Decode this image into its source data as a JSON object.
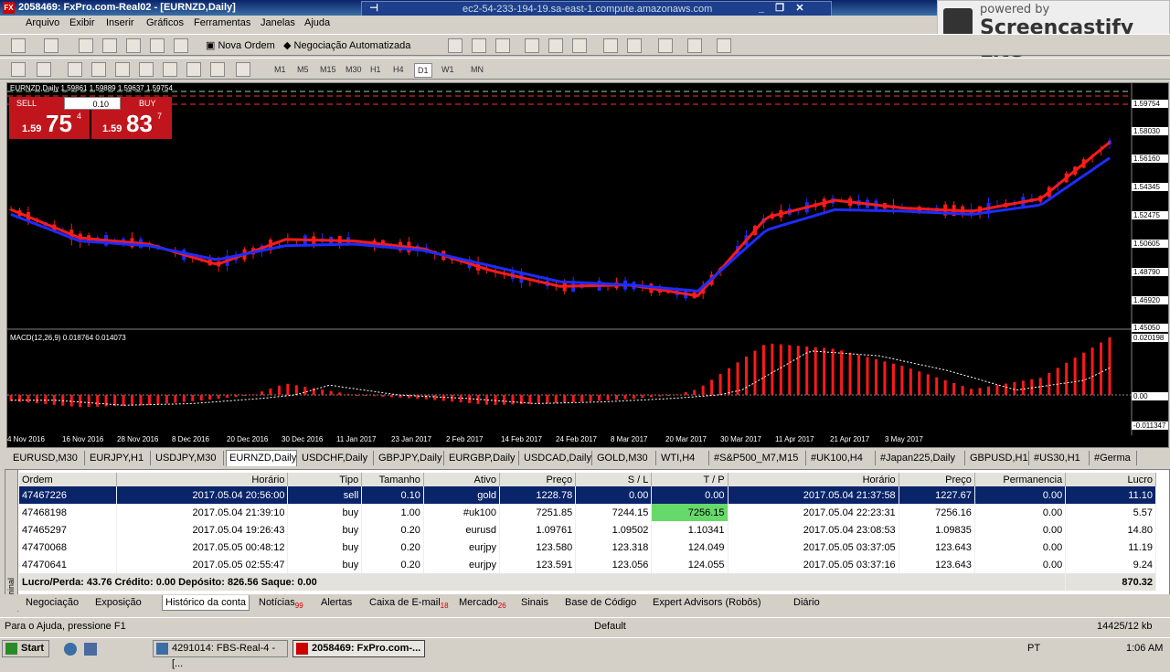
{
  "window": {
    "title": "2058469: FxPro.com-Real02 - [EURNZD,Daily]",
    "rdp_host": "ec2-54-233-194-19.sa-east-1.compute.amazonaws.com"
  },
  "branding": {
    "line1": "powered by",
    "line2": "Screencastify Lite"
  },
  "menu": [
    "Arquivo",
    "Exibir",
    "Inserir",
    "Gráficos",
    "Ferramentas",
    "Janelas",
    "Ajuda"
  ],
  "toolbar": {
    "new_order": "Nova Ordem",
    "auto_trading": "Negociação Automatizada"
  },
  "timeframes": [
    "M1",
    "M5",
    "M15",
    "M30",
    "H1",
    "H4",
    "D1",
    "W1",
    "MN"
  ],
  "trade_panel": {
    "sell": "SELL",
    "buy": "BUY",
    "volume": "0.10",
    "sell_prefix": "1.59",
    "sell_big": "75",
    "sell_sup": "4",
    "buy_prefix": "1.59",
    "buy_big": "83",
    "buy_sup": "7"
  },
  "chart": {
    "header": "EURNZD,Daily 1.59861 1.59889 1.59637 1.59754",
    "macd_label": "MACD(12,26,9) 0.018764 0.014073",
    "price_ticks": [
      "1.59754",
      "1.58030",
      "1.56160",
      "1.54345",
      "1.52475",
      "1.50605",
      "1.48790",
      "1.46920",
      "1.45050"
    ],
    "macd_ticks": [
      "0.020198",
      "0.00",
      "-0.011347"
    ],
    "date_ticks": [
      "4 Nov 2016",
      "16 Nov 2016",
      "28 Nov 2016",
      "8 Dec 2016",
      "20 Dec 2016",
      "30 Dec 2016",
      "11 Jan 2017",
      "23 Jan 2017",
      "2 Feb 2017",
      "14 Feb 2017",
      "24 Feb 2017",
      "8 Mar 2017",
      "20 Mar 2017",
      "30 Mar 2017",
      "11 Apr 2017",
      "21 Apr 2017",
      "3 May 2017"
    ],
    "colors": {
      "bull": "#1e2cff",
      "bear": "#ff1a1a",
      "bg": "#000000"
    }
  },
  "chart_data": {
    "type": "line",
    "title": "EURNZD,Daily",
    "x": [
      "4 Nov 2016",
      "16 Nov 2016",
      "28 Nov 2016",
      "8 Dec 2016",
      "20 Dec 2016",
      "30 Dec 2016",
      "11 Jan 2017",
      "23 Jan 2017",
      "2 Feb 2017",
      "14 Feb 2017",
      "24 Feb 2017",
      "8 Mar 2017",
      "20 Mar 2017",
      "30 Mar 2017",
      "11 Apr 2017",
      "21 Apr 2017",
      "3 May 2017"
    ],
    "series": [
      {
        "values": [
          1.525,
          1.507,
          1.503,
          1.49,
          1.506,
          1.505,
          1.5,
          1.486,
          1.476,
          1.477,
          1.47,
          1.52,
          1.531,
          1.526,
          1.524,
          1.532,
          1.568
        ]
      },
      {
        "values": [
          1.522,
          1.505,
          1.502,
          1.493,
          1.502,
          1.503,
          1.499,
          1.489,
          1.479,
          1.477,
          1.473,
          1.512,
          1.525,
          1.524,
          1.522,
          1.528,
          1.558
        ]
      }
    ],
    "ylim": [
      1.4505,
      1.5975
    ]
  },
  "symbol_tabs": [
    "EURUSD,M30",
    "EURJPY,H1",
    "USDJPY,M30",
    "EURNZD,Daily",
    "USDCHF,Daily",
    "GBPJPY,Daily",
    "EURGBP,Daily",
    "USDCAD,Daily",
    "GOLD,M30",
    "WTI,H4",
    "#S&P500_M7,M15",
    "#UK100,H4",
    "#Japan225,Daily",
    "GBPUSD,H1",
    "#US30,H1",
    "#Germa"
  ],
  "terminal": {
    "side_label": "Terminal",
    "columns": [
      "Ordem",
      "Horário",
      "Tipo",
      "Tamanho",
      "Ativo",
      "Preço",
      "S / L",
      "T / P",
      "Horário",
      "Preço",
      "Permanencia",
      "Lucro"
    ],
    "rows": [
      [
        "47467226",
        "2017.05.04 20:56:00",
        "sell",
        "0.10",
        "gold",
        "1228.78",
        "0.00",
        "0.00",
        "2017.05.04 21:37:58",
        "1227.67",
        "0.00",
        "11.10"
      ],
      [
        "47468198",
        "2017.05.04 21:39:10",
        "buy",
        "1.00",
        "#uk100",
        "7251.85",
        "7244.15",
        "7256.15",
        "2017.05.04 22:23:31",
        "7256.16",
        "0.00",
        "5.57"
      ],
      [
        "47465297",
        "2017.05.04 19:26:43",
        "buy",
        "0.20",
        "eurusd",
        "1.09761",
        "1.09502",
        "1.10341",
        "2017.05.04 23:08:53",
        "1.09835",
        "0.00",
        "14.80"
      ],
      [
        "47470068",
        "2017.05.05 00:48:12",
        "buy",
        "0.20",
        "eurjpy",
        "123.580",
        "123.318",
        "124.049",
        "2017.05.05 03:37:05",
        "123.643",
        "0.00",
        "11.19"
      ],
      [
        "47470641",
        "2017.05.05 02:55:47",
        "buy",
        "0.20",
        "eurjpy",
        "123.591",
        "123.056",
        "124.055",
        "2017.05.05 03:37:16",
        "123.643",
        "0.00",
        "9.24"
      ]
    ],
    "summary": "Lucro/Perda: 43.76  Crédito: 0.00  Depósito: 826.56  Saque: 0.00",
    "summary_total": "870.32"
  },
  "bottom_tabs": [
    {
      "label": "Negociação"
    },
    {
      "label": "Exposição"
    },
    {
      "label": "Histórico da conta"
    },
    {
      "label": "Notícias",
      "badge": "99"
    },
    {
      "label": "Alertas"
    },
    {
      "label": "Caixa de E-mail",
      "badge": "18"
    },
    {
      "label": "Mercado",
      "badge": "26"
    },
    {
      "label": "Sinais"
    },
    {
      "label": "Base de Código"
    },
    {
      "label": "Expert Advisors (Robôs)"
    },
    {
      "label": "Diário"
    }
  ],
  "status": {
    "help": "Para o Ajuda, pressione F1",
    "profile": "Default",
    "traffic": "14425/12 kb"
  },
  "taskbar": {
    "start": "Start",
    "task1": "4291014: FBS-Real-4 - [...",
    "task2": "2058469: FxPro.com-...",
    "lang": "PT",
    "clock": "1:06 AM"
  }
}
